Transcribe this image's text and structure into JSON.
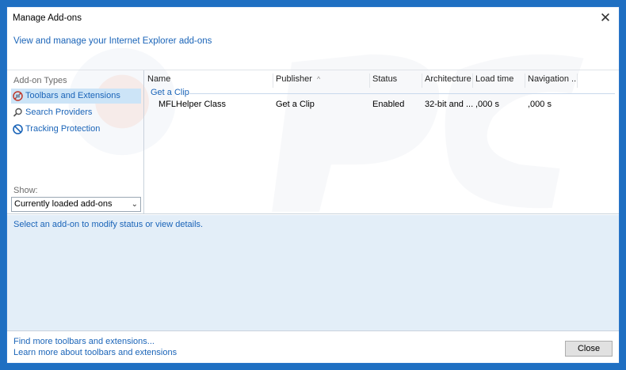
{
  "window": {
    "title": "Manage Add-ons",
    "close_glyph": "✕",
    "header_link": "View and manage your Internet Explorer add-ons"
  },
  "sidebar": {
    "heading": "Add-on Types",
    "items": [
      {
        "label": "Toolbars and Extensions",
        "icon": "toolbars-icon",
        "selected": true
      },
      {
        "label": "Search Providers",
        "icon": "search-icon",
        "selected": false
      },
      {
        "label": "Tracking Protection",
        "icon": "tracking-protection-icon",
        "selected": false
      }
    ],
    "show_label": "Show:",
    "show_value": "Currently loaded add-ons"
  },
  "list": {
    "columns": [
      "Name",
      "Publisher",
      "Status",
      "Architecture",
      "Load time",
      "Navigation ..."
    ],
    "group": "Get a Clip",
    "rows": [
      {
        "name": "MFLHelper Class",
        "publisher": "Get a Clip",
        "status": "Enabled",
        "architecture": "32-bit and ...",
        "load_time": ",000 s",
        "navigation": ",000 s"
      }
    ]
  },
  "details": {
    "prompt": "Select an add-on to modify status or view details."
  },
  "footer": {
    "links": [
      "Find more toolbars and extensions...",
      "Learn more about toolbars and extensions"
    ],
    "close_label": "Close"
  },
  "colors": {
    "accent": "#1a64b8",
    "frame": "#1f6fc2",
    "selection": "#cce4f7",
    "details_bg": "#e3eef8"
  }
}
